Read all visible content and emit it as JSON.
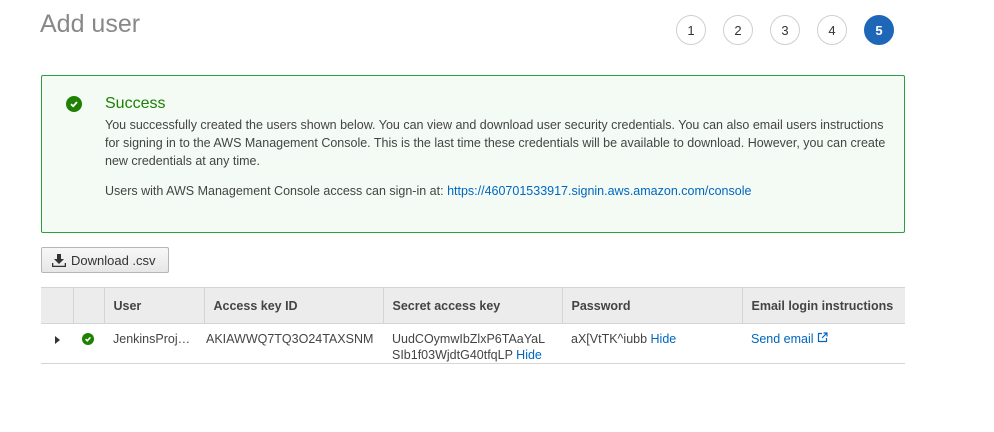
{
  "page": {
    "title": "Add user"
  },
  "steps": [
    "1",
    "2",
    "3",
    "4",
    "5"
  ],
  "alert": {
    "title": "Success",
    "message": "You successfully created the users shown below. You can view and download user security credentials. You can also email users instructions for signing in to the AWS Management Console. This is the last time these credentials will be available to download. However, you can create new credentials at any time.",
    "signin_prefix": "Users with AWS Management Console access can sign-in at: ",
    "signin_url": "https://460701533917.signin.aws.amazon.com/console",
    "icon": "check-circle-icon",
    "color": "#1d8102"
  },
  "download_button": {
    "label": "Download .csv",
    "icon": "download-icon"
  },
  "table": {
    "columns": [
      "User",
      "Access key ID",
      "Secret access key",
      "Password",
      "Email login instructions"
    ],
    "rows": [
      {
        "user": "JenkinsProj…",
        "access_key_id": "AKIAWWQ7TQ3O24TAXSNM",
        "secret_line1": "UudCOymwIbZlxP6TAaYaL",
        "secret_line2": "SIb1f03WjdtG40tfqLP",
        "secret_hide": "Hide",
        "password": "aX[VtTK^iubb",
        "password_hide": "Hide",
        "send_email": "Send email"
      }
    ]
  },
  "colors": {
    "accent": "#1e66b8",
    "link": "#0066c0",
    "success": "#1d8102"
  }
}
